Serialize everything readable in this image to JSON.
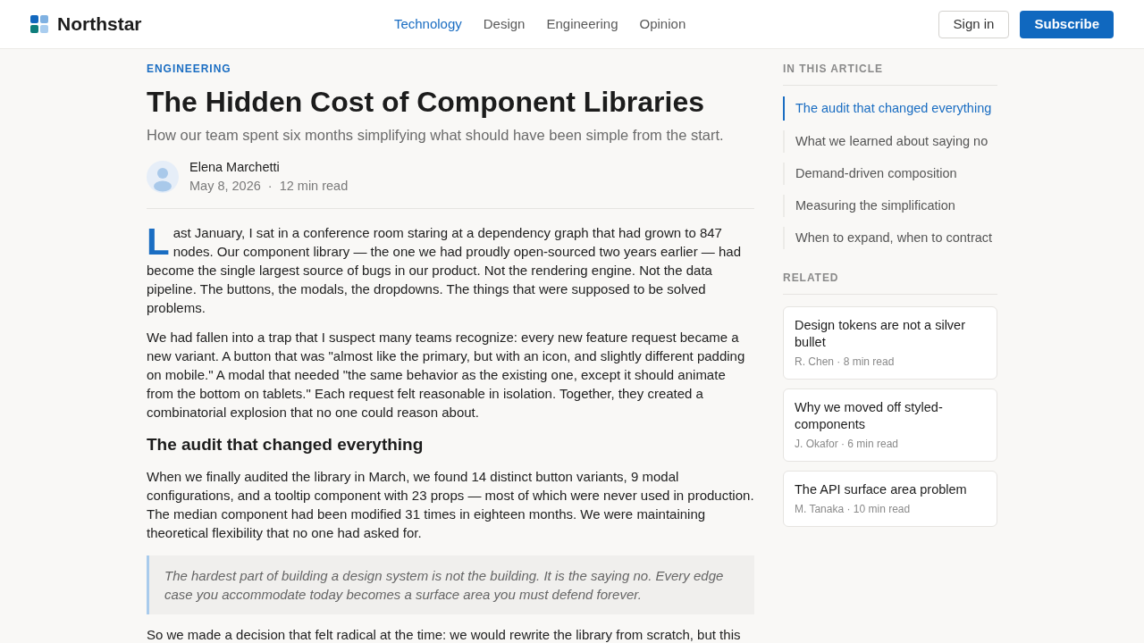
{
  "header": {
    "brand": "Northstar",
    "nav": [
      {
        "label": "Technology",
        "selected": true
      },
      {
        "label": "Design",
        "selected": false
      },
      {
        "label": "Engineering",
        "selected": false
      },
      {
        "label": "Opinion",
        "selected": false
      }
    ],
    "buttons": [
      {
        "label": "Sign in",
        "kind": "outline"
      },
      {
        "label": "Subscribe",
        "kind": "primary"
      }
    ]
  },
  "article": {
    "category": "ENGINEERING",
    "title": "The Hidden Cost of Component Libraries",
    "subtitle": "How our team spent six months simplifying what should have been simple from the start.",
    "author": {
      "name": "Elena Marchetti",
      "date": "May 8, 2026",
      "separator": "·",
      "read_time": "12 min read"
    },
    "body": [
      {
        "kind": "paragraph",
        "drop_cap": "L",
        "text": "ast January, I sat in a conference room staring at a dependency graph that had grown to 847 nodes. Our component library — the one we had proudly open-sourced two years earlier — had become the single largest source of bugs in our product. Not the rendering engine. Not the data pipeline. The buttons, the modals, the dropdowns. The things that were supposed to be solved problems."
      },
      {
        "kind": "paragraph",
        "text": "We had fallen into a trap that I suspect many teams recognize: every new feature request became a new variant. A button that was \"almost like the primary, but with an icon, and slightly different padding on mobile.\" A modal that needed \"the same behavior as the existing one, except it should animate from the bottom on tablets.\" Each request felt reasonable in isolation. Together, they created a combinatorial explosion that no one could reason about."
      },
      {
        "kind": "heading",
        "text": "The audit that changed everything"
      },
      {
        "kind": "paragraph",
        "text": "When we finally audited the library in March, we found 14 distinct button variants, 9 modal configurations, and a tooltip component with 23 props — most of which were never used in production. The median component had been modified 31 times in eighteen months. We were maintaining theoretical flexibility that no one had asked for."
      },
      {
        "kind": "quote",
        "text": "The hardest part of building a design system is not the building. It is the saying no. Every edge case you accommodate today becomes a surface area you must defend forever."
      },
      {
        "kind": "paragraph",
        "text": "So we made a decision that felt radical at the time: we would rewrite the library from scratch, but this"
      }
    ]
  },
  "sidebar": {
    "toc_title": "IN THIS ARTICLE",
    "toc": [
      {
        "label": "The audit that changed everything",
        "selected": true
      },
      {
        "label": "What we learned about saying no",
        "selected": false
      },
      {
        "label": "Demand-driven composition",
        "selected": false
      },
      {
        "label": "Measuring the simplification",
        "selected": false
      },
      {
        "label": "When to expand, when to contract",
        "selected": false
      }
    ],
    "related_title": "RELATED",
    "related": [
      {
        "title": "Design tokens are not a silver bullet",
        "meta": "R. Chen · 8 min read"
      },
      {
        "title": "Why we moved off styled-components",
        "meta": "J. Okafor · 6 min read"
      },
      {
        "title": "The API surface area problem",
        "meta": "M. Tanaka · 10 min read"
      }
    ]
  }
}
